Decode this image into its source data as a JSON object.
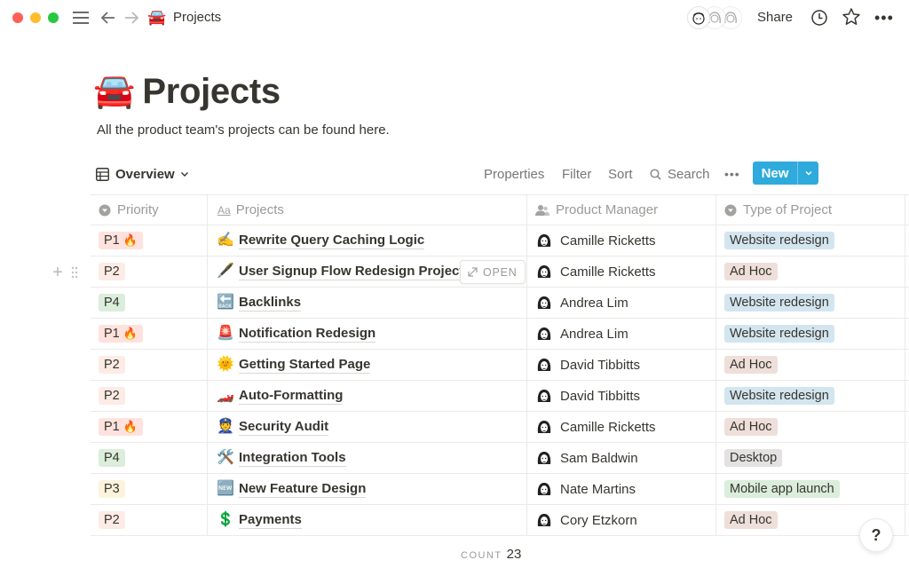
{
  "window": {
    "breadcrumb_emoji": "🚘",
    "breadcrumb_title": "Projects",
    "share_label": "Share",
    "more_label": "•••",
    "collaborators": [
      "collaborator-1",
      "collaborator-2",
      "collaborator-3"
    ]
  },
  "page": {
    "emoji": "🚘",
    "title": "Projects",
    "description": "All the product team's projects can be found here."
  },
  "viewbar": {
    "view_name": "Overview",
    "properties_label": "Properties",
    "filter_label": "Filter",
    "sort_label": "Sort",
    "search_label": "Search",
    "more_label": "•••",
    "new_label": "New"
  },
  "table": {
    "columns": [
      {
        "label": "Priority",
        "icon": "select-icon"
      },
      {
        "label": "Projects",
        "icon": "title-icon"
      },
      {
        "label": "Product Manager",
        "icon": "person-icon"
      },
      {
        "label": "Type of Project",
        "icon": "select-icon"
      }
    ],
    "open_label": "OPEN",
    "rows": [
      {
        "priority": "P1",
        "fire": "🔥",
        "emoji": "✍️",
        "project": "Rewrite Query Caching Logic",
        "manager": "Camille Ricketts",
        "type": "Website redesign",
        "type_class": "website"
      },
      {
        "priority": "P2",
        "fire": "",
        "emoji": "🖋️",
        "project": "User Signup Flow Redesign Project",
        "manager": "Camille Ricketts",
        "type": "Ad Hoc",
        "type_class": "adhoc"
      },
      {
        "priority": "P4",
        "fire": "",
        "emoji": "🔙",
        "project": "Backlinks",
        "manager": "Andrea Lim",
        "type": "Website redesign",
        "type_class": "website"
      },
      {
        "priority": "P1",
        "fire": "🔥",
        "emoji": "🚨",
        "project": "Notification Redesign",
        "manager": "Andrea Lim",
        "type": "Website redesign",
        "type_class": "website"
      },
      {
        "priority": "P2",
        "fire": "",
        "emoji": "🌞",
        "project": "Getting Started Page",
        "manager": "David Tibbitts",
        "type": "Ad Hoc",
        "type_class": "adhoc"
      },
      {
        "priority": "P2",
        "fire": "",
        "emoji": "🏎️",
        "project": "Auto-Formatting",
        "manager": "David Tibbitts",
        "type": "Website redesign",
        "type_class": "website"
      },
      {
        "priority": "P1",
        "fire": "🔥",
        "emoji": "👮",
        "project": "Security Audit",
        "manager": "Camille Ricketts",
        "type": "Ad Hoc",
        "type_class": "adhoc"
      },
      {
        "priority": "P4",
        "fire": "",
        "emoji": "🛠️",
        "project": "Integration Tools",
        "manager": "Sam Baldwin",
        "type": "Desktop",
        "type_class": "desktop"
      },
      {
        "priority": "P3",
        "fire": "",
        "emoji": "🆕",
        "project": "New Feature Design",
        "manager": "Nate Martins",
        "type": "Mobile app launch",
        "type_class": "mobile"
      },
      {
        "priority": "P2",
        "fire": "",
        "emoji": "💲",
        "project": "Payments",
        "manager": "Cory Etzkorn",
        "type": "Ad Hoc",
        "type_class": "adhoc"
      }
    ]
  },
  "footer": {
    "count_label": "COUNT",
    "count_value": "23",
    "help_label": "?"
  },
  "colors": {
    "accent": "#2eaadc",
    "p1": "#ffe2dd",
    "p2": "#fdebe5",
    "p3": "#fbf3db",
    "p4": "#dbeddb",
    "website": "#d3e5ef",
    "adhoc": "#eedfda",
    "desktop": "#e3e2e0",
    "mobile": "#dbeddb"
  }
}
